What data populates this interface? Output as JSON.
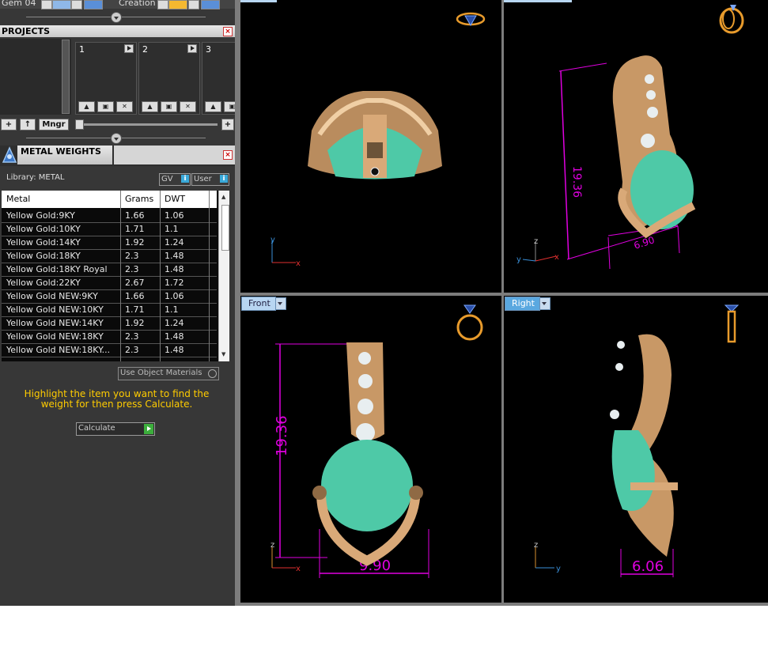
{
  "topbar": {
    "left_text": "Gem 04",
    "right_text": "Creation"
  },
  "projects": {
    "title": "PROJECTS",
    "slots": [
      "1",
      "2",
      "3"
    ],
    "buttons": {
      "add": "+",
      "up": "↑",
      "manager": "Mngr",
      "zoom_plus": "+"
    }
  },
  "metal_weights": {
    "title": "METAL WEIGHTS",
    "library_label": "Library: METAL",
    "toggle_gv": "GV",
    "toggle_user": "User",
    "columns": [
      "Metal",
      "Grams",
      "DWT"
    ],
    "rows": [
      [
        "Yellow Gold:9KY",
        "1.66",
        "1.06"
      ],
      [
        "Yellow Gold:10KY",
        "1.71",
        "1.1"
      ],
      [
        "Yellow Gold:14KY",
        "1.92",
        "1.24"
      ],
      [
        "Yellow Gold:18KY",
        "2.3",
        "1.48"
      ],
      [
        "Yellow Gold:18KY Royal",
        "2.3",
        "1.48"
      ],
      [
        "Yellow Gold:22KY",
        "2.67",
        "1.72"
      ],
      [
        "Yellow Gold NEW:9KY",
        "1.66",
        "1.06"
      ],
      [
        "Yellow Gold NEW:10KY",
        "1.71",
        "1.1"
      ],
      [
        "Yellow Gold NEW:14KY",
        "1.92",
        "1.24"
      ],
      [
        "Yellow Gold NEW:18KY",
        "2.3",
        "1.48"
      ],
      [
        "Yellow Gold NEW:18KY...",
        "2.3",
        "1.48"
      ]
    ],
    "use_object_materials": "Use Object Materials",
    "instruction": "Highlight the item you want to find the weight for then press Calculate.",
    "calculate_label": "Calculate"
  },
  "viewports": {
    "front_label": "Front",
    "right_label": "Right",
    "dim_height": "19.36",
    "dim_width_front": "9.90",
    "dim_width_right": "6.06",
    "dim_persp_height": "19.36",
    "dim_persp_width": "6.90",
    "axis_x": "x",
    "axis_y": "y",
    "axis_z": "z"
  },
  "colors": {
    "gold": "#d9a978",
    "gem": "#5fd6b5",
    "dimension": "#e000e0",
    "instruction_text": "#ffcc00",
    "viewport_bg": "#000000",
    "panel_bg": "#373737"
  },
  "icons": [
    "triangle-arrow-icon",
    "close-icon",
    "ring-preview-icon",
    "upload-icon",
    "save-icon",
    "delete-icon",
    "play-icon"
  ]
}
